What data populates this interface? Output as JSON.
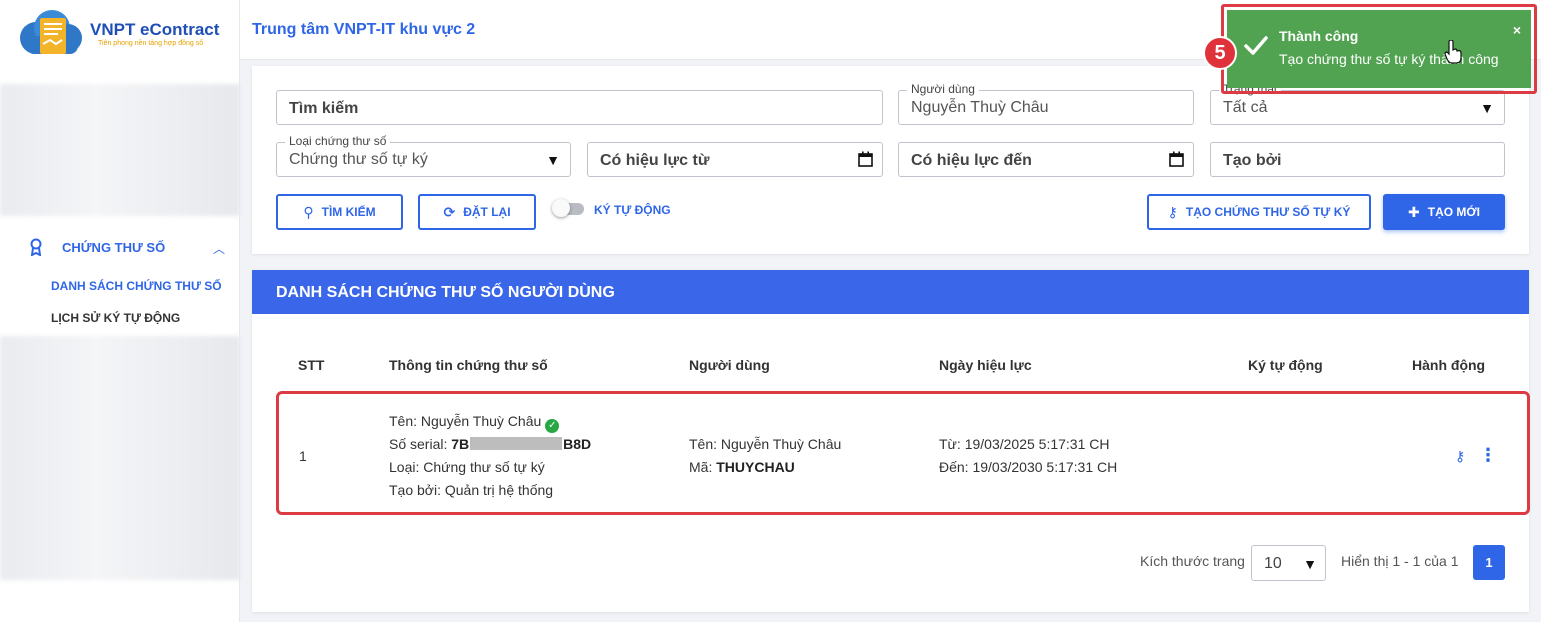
{
  "brand": {
    "name": "VNPT eContract",
    "tagline": "Tiên phong nền tảng hợp đồng số"
  },
  "header": {
    "title": "Trung tâm VNPT-IT khu vực 2"
  },
  "sidebar": {
    "group_label": "CHỨNG THƯ SỐ",
    "items": [
      {
        "label": "DANH SÁCH CHỨNG THƯ SỐ",
        "active": true
      },
      {
        "label": "LỊCH SỬ KÝ TỰ ĐỘNG",
        "active": false
      }
    ]
  },
  "filters": {
    "search_placeholder": "Tìm kiếm",
    "user_label": "Người dùng",
    "user_value": "Nguyễn Thuỳ Châu",
    "status_label": "Trạng thái",
    "status_value": "Tất cả",
    "type_label": "Loại chứng thư số",
    "type_value": "Chứng thư số tự ký",
    "valid_from_placeholder": "Có hiệu lực từ",
    "valid_to_placeholder": "Có hiệu lực đến",
    "created_by_placeholder": "Tạo bởi"
  },
  "actions": {
    "search": "TÌM KIẾM",
    "reset": "ĐẶT LẠI",
    "auto_sign": "KÝ TỰ ĐỘNG",
    "auto_sign_on": false,
    "create_self_signed": "TẠO CHỨNG THƯ SỐ TỰ KÝ",
    "create_new": "TẠO MỚI"
  },
  "table": {
    "title": "DANH SÁCH CHỨNG THƯ SỐ NGƯỜI DÙNG",
    "columns": [
      "STT",
      "Thông tin chứng thư số",
      "Người dùng",
      "Ngày hiệu lực",
      "Ký tự động",
      "Hành động"
    ],
    "rows": [
      {
        "stt": "1",
        "cert_name": "Tên: Nguyễn Thuỳ Châu",
        "serial_label": "Số serial: ",
        "serial_start": "7B",
        "serial_end": "B8D",
        "cert_type": "Loại: Chứng thư số tự ký",
        "created_by": "Tạo bởi: Quản trị hệ thống",
        "user_name": "Tên: Nguyễn Thuỳ Châu",
        "user_code_label": "Mã: ",
        "user_code": "THUYCHAU",
        "valid_from": "Từ: 19/03/2025 5:17:31 CH",
        "valid_to": "Đến: 19/03/2030 5:17:31 CH",
        "auto_sign": ""
      }
    ]
  },
  "pagination": {
    "page_size_label": "Kích thước trang",
    "page_size": "10",
    "summary": "Hiển thị 1 - 1 của 1",
    "current_page": "1"
  },
  "toast": {
    "title": "Thành công",
    "message": "Tạo chứng thư số tự ký thành công",
    "close": "×"
  },
  "step_badge": "5",
  "colors": {
    "primary": "#2f66e8",
    "toast_bg": "#51a351",
    "highlight": "#dd3b43"
  }
}
